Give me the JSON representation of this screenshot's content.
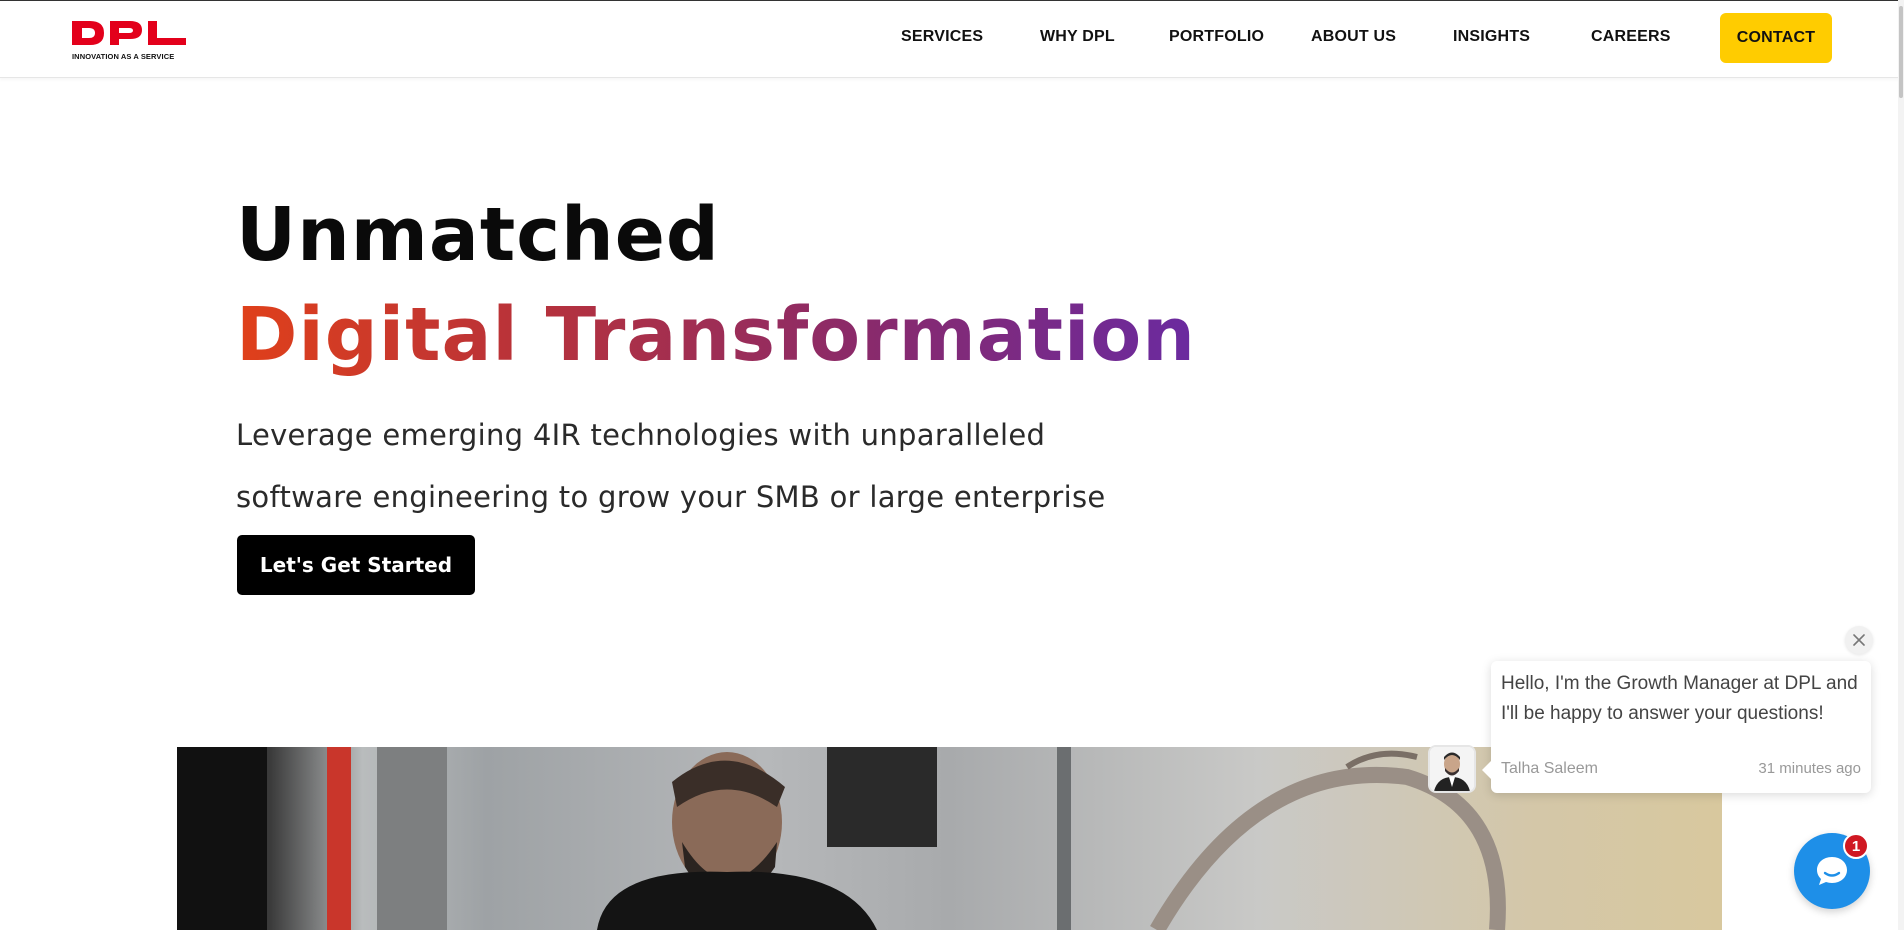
{
  "brand": {
    "logo_text": "DPL",
    "tagline": "INNOVATION AS A SERVICE",
    "logo_color": "#e3001b"
  },
  "nav": {
    "items": [
      {
        "label": "SERVICES"
      },
      {
        "label": "WHY DPL"
      },
      {
        "label": "PORTFOLIO"
      },
      {
        "label": "ABOUT US"
      },
      {
        "label": "INSIGHTS"
      },
      {
        "label": "CAREERS"
      }
    ],
    "contact_label": "CONTACT",
    "contact_color": "#ffcc00"
  },
  "hero": {
    "title_line1": "Unmatched",
    "title_line2": "Digital Transformation",
    "subtitle_line1": "Leverage emerging 4IR technologies with unparalleled",
    "subtitle_line2": "software engineering to grow your SMB or large enterprise",
    "cta_label": "Let's Get Started",
    "gradient_colors": [
      "#e0401a",
      "#b8323a",
      "#8a2a6a",
      "#6a2aa0"
    ]
  },
  "chat": {
    "message": "Hello, I'm the Growth Manager at DPL and I'll be happy to answer your questions!",
    "sender_name": "Talha Saleem",
    "time_ago": "31 minutes ago",
    "unread_count": "1",
    "launcher_color": "#1e8fe8"
  }
}
